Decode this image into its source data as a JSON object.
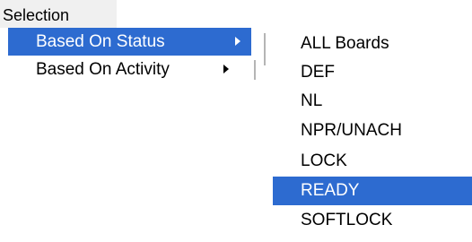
{
  "menu": {
    "title": "Selection"
  },
  "submenu": {
    "items": [
      {
        "label": "Based On Status"
      },
      {
        "label": "Based On Activity"
      }
    ]
  },
  "status_list": {
    "items": [
      {
        "label": "ALL Boards"
      },
      {
        "label": "DEF"
      },
      {
        "label": "NL"
      },
      {
        "label": "NPR/UNACH"
      },
      {
        "label": "LOCK"
      },
      {
        "label": "READY"
      },
      {
        "label": "SOFTLOCK"
      }
    ],
    "selected": "READY"
  },
  "colors": {
    "highlight": "#2d6bd0",
    "menubar_bg": "#f0f0f0",
    "separator": "#b5b5b5"
  },
  "icons": {
    "submenu_arrow": "triangle-right"
  }
}
